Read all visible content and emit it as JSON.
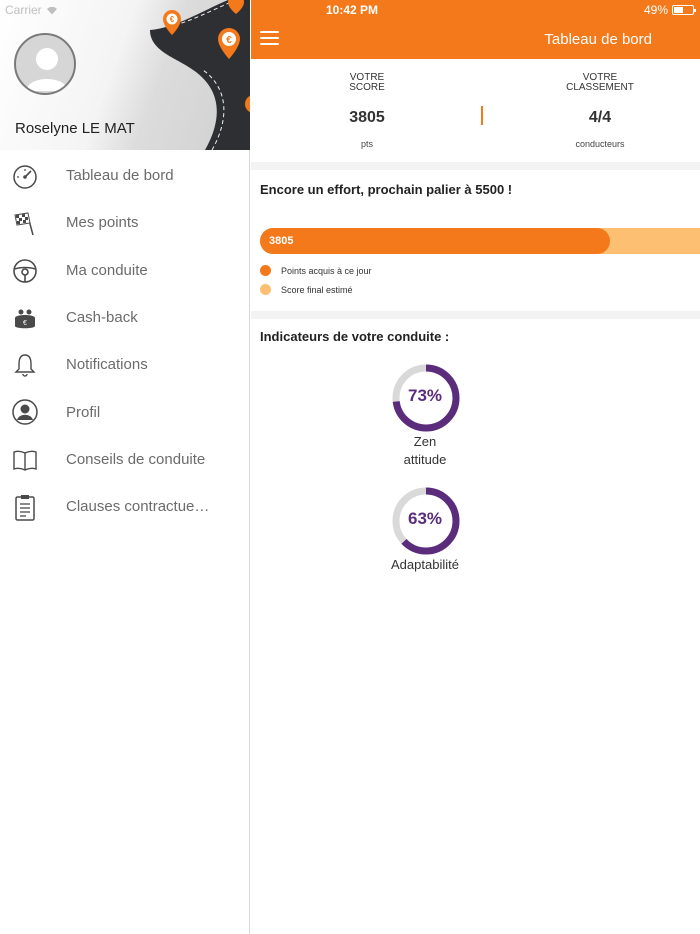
{
  "status_bar": {
    "carrier": "Carrier",
    "time": "10:42 PM",
    "battery": "49%"
  },
  "sidebar": {
    "user_name": "Roselyne LE MAT",
    "items": [
      {
        "label": "Tableau de bord",
        "icon": "speedometer-icon"
      },
      {
        "label": "Mes points",
        "icon": "checkered-flag-icon"
      },
      {
        "label": "Ma conduite",
        "icon": "steering-wheel-icon"
      },
      {
        "label": "Cash-back",
        "icon": "purse-icon"
      },
      {
        "label": "Notifications",
        "icon": "bell-icon"
      },
      {
        "label": "Profil",
        "icon": "user-icon"
      },
      {
        "label": "Conseils de conduite",
        "icon": "book-icon"
      },
      {
        "label": "Clauses contractue…",
        "icon": "clipboard-icon"
      }
    ]
  },
  "header": {
    "title": "Tableau de bord"
  },
  "score": {
    "score_caption_1": "VOTRE",
    "score_caption_2": "SCORE",
    "score_value": "3805",
    "score_unit": "pts",
    "rank_caption_1": "VOTRE",
    "rank_caption_2": "CLASSEMENT",
    "rank_value": "4/4",
    "rank_unit": "conducteurs"
  },
  "progress": {
    "message": "Encore un effort,  prochain palier à 5500 !",
    "bar_label": "3805",
    "fraction": 0.795,
    "legend": [
      {
        "label": "Points acquis à ce jour",
        "color": "#f4791a"
      },
      {
        "label": "Score final estimé",
        "color": "#fdbf72"
      }
    ]
  },
  "indicators": {
    "title": "Indicateurs de votre conduite :",
    "items": [
      {
        "percent": "73%",
        "value": 73,
        "label_line1": "Zen",
        "label_line2": "attitude"
      },
      {
        "percent": "63%",
        "value": 63,
        "label_line1": "Adaptabilité",
        "label_line2": ""
      }
    ]
  },
  "colors": {
    "accent": "#f4791a",
    "accent_light": "#fdbf72",
    "gauge": "#5c2c7c",
    "gauge_track": "#d9d9d9"
  }
}
